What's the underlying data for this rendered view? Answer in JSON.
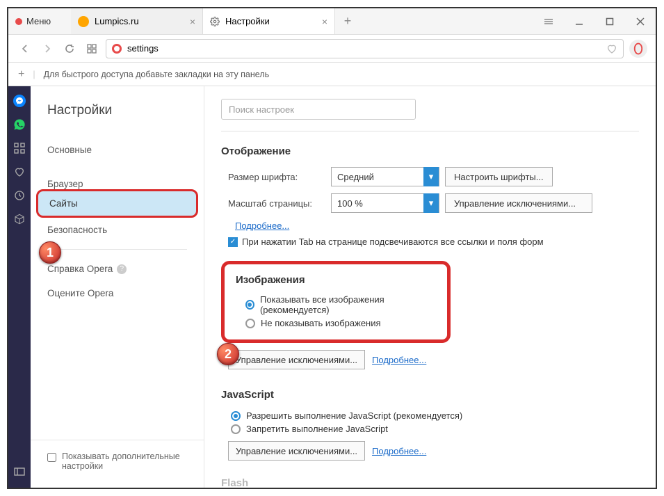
{
  "window": {
    "menu_label": "Меню"
  },
  "tabs": [
    {
      "label": "Lumpics.ru"
    },
    {
      "label": "Настройки"
    }
  ],
  "address": {
    "value": "settings"
  },
  "bookmarks": {
    "hint": "Для быстрого доступа добавьте закладки на эту панель"
  },
  "settings_nav": {
    "title": "Настройки",
    "items": {
      "basic": "Основные",
      "browser": "Браузер",
      "sites": "Сайты",
      "security": "Безопасность",
      "help": "Справка Opera",
      "rate": "Оцените Opera"
    },
    "advanced_cb": "Показывать дополнительные настройки"
  },
  "content": {
    "search_placeholder": "Поиск настроек",
    "display": {
      "heading": "Отображение",
      "font_label": "Размер шрифта:",
      "font_value": "Средний",
      "fonts_btn": "Настроить шрифты...",
      "zoom_label": "Масштаб страницы:",
      "zoom_value": "100 %",
      "exceptions_btn": "Управление исключениями...",
      "more": "Подробнее...",
      "tab_hint": "При нажатии Tab на странице подсвечиваются все ссылки и поля форм"
    },
    "images": {
      "heading": "Изображения",
      "opt_show": "Показывать все изображения (рекомендуется)",
      "opt_hide": "Не показывать изображения",
      "exceptions_btn": "Управление исключениями...",
      "more": "Подробнее..."
    },
    "js": {
      "heading": "JavaScript",
      "opt_allow": "Разрешить выполнение JavaScript (рекомендуется)",
      "opt_block": "Запретить выполнение JavaScript",
      "exceptions_btn": "Управление исключениями...",
      "more": "Подробнее..."
    },
    "flash_heading": "Flash"
  },
  "annotations": {
    "callout1": "1",
    "callout2": "2"
  }
}
